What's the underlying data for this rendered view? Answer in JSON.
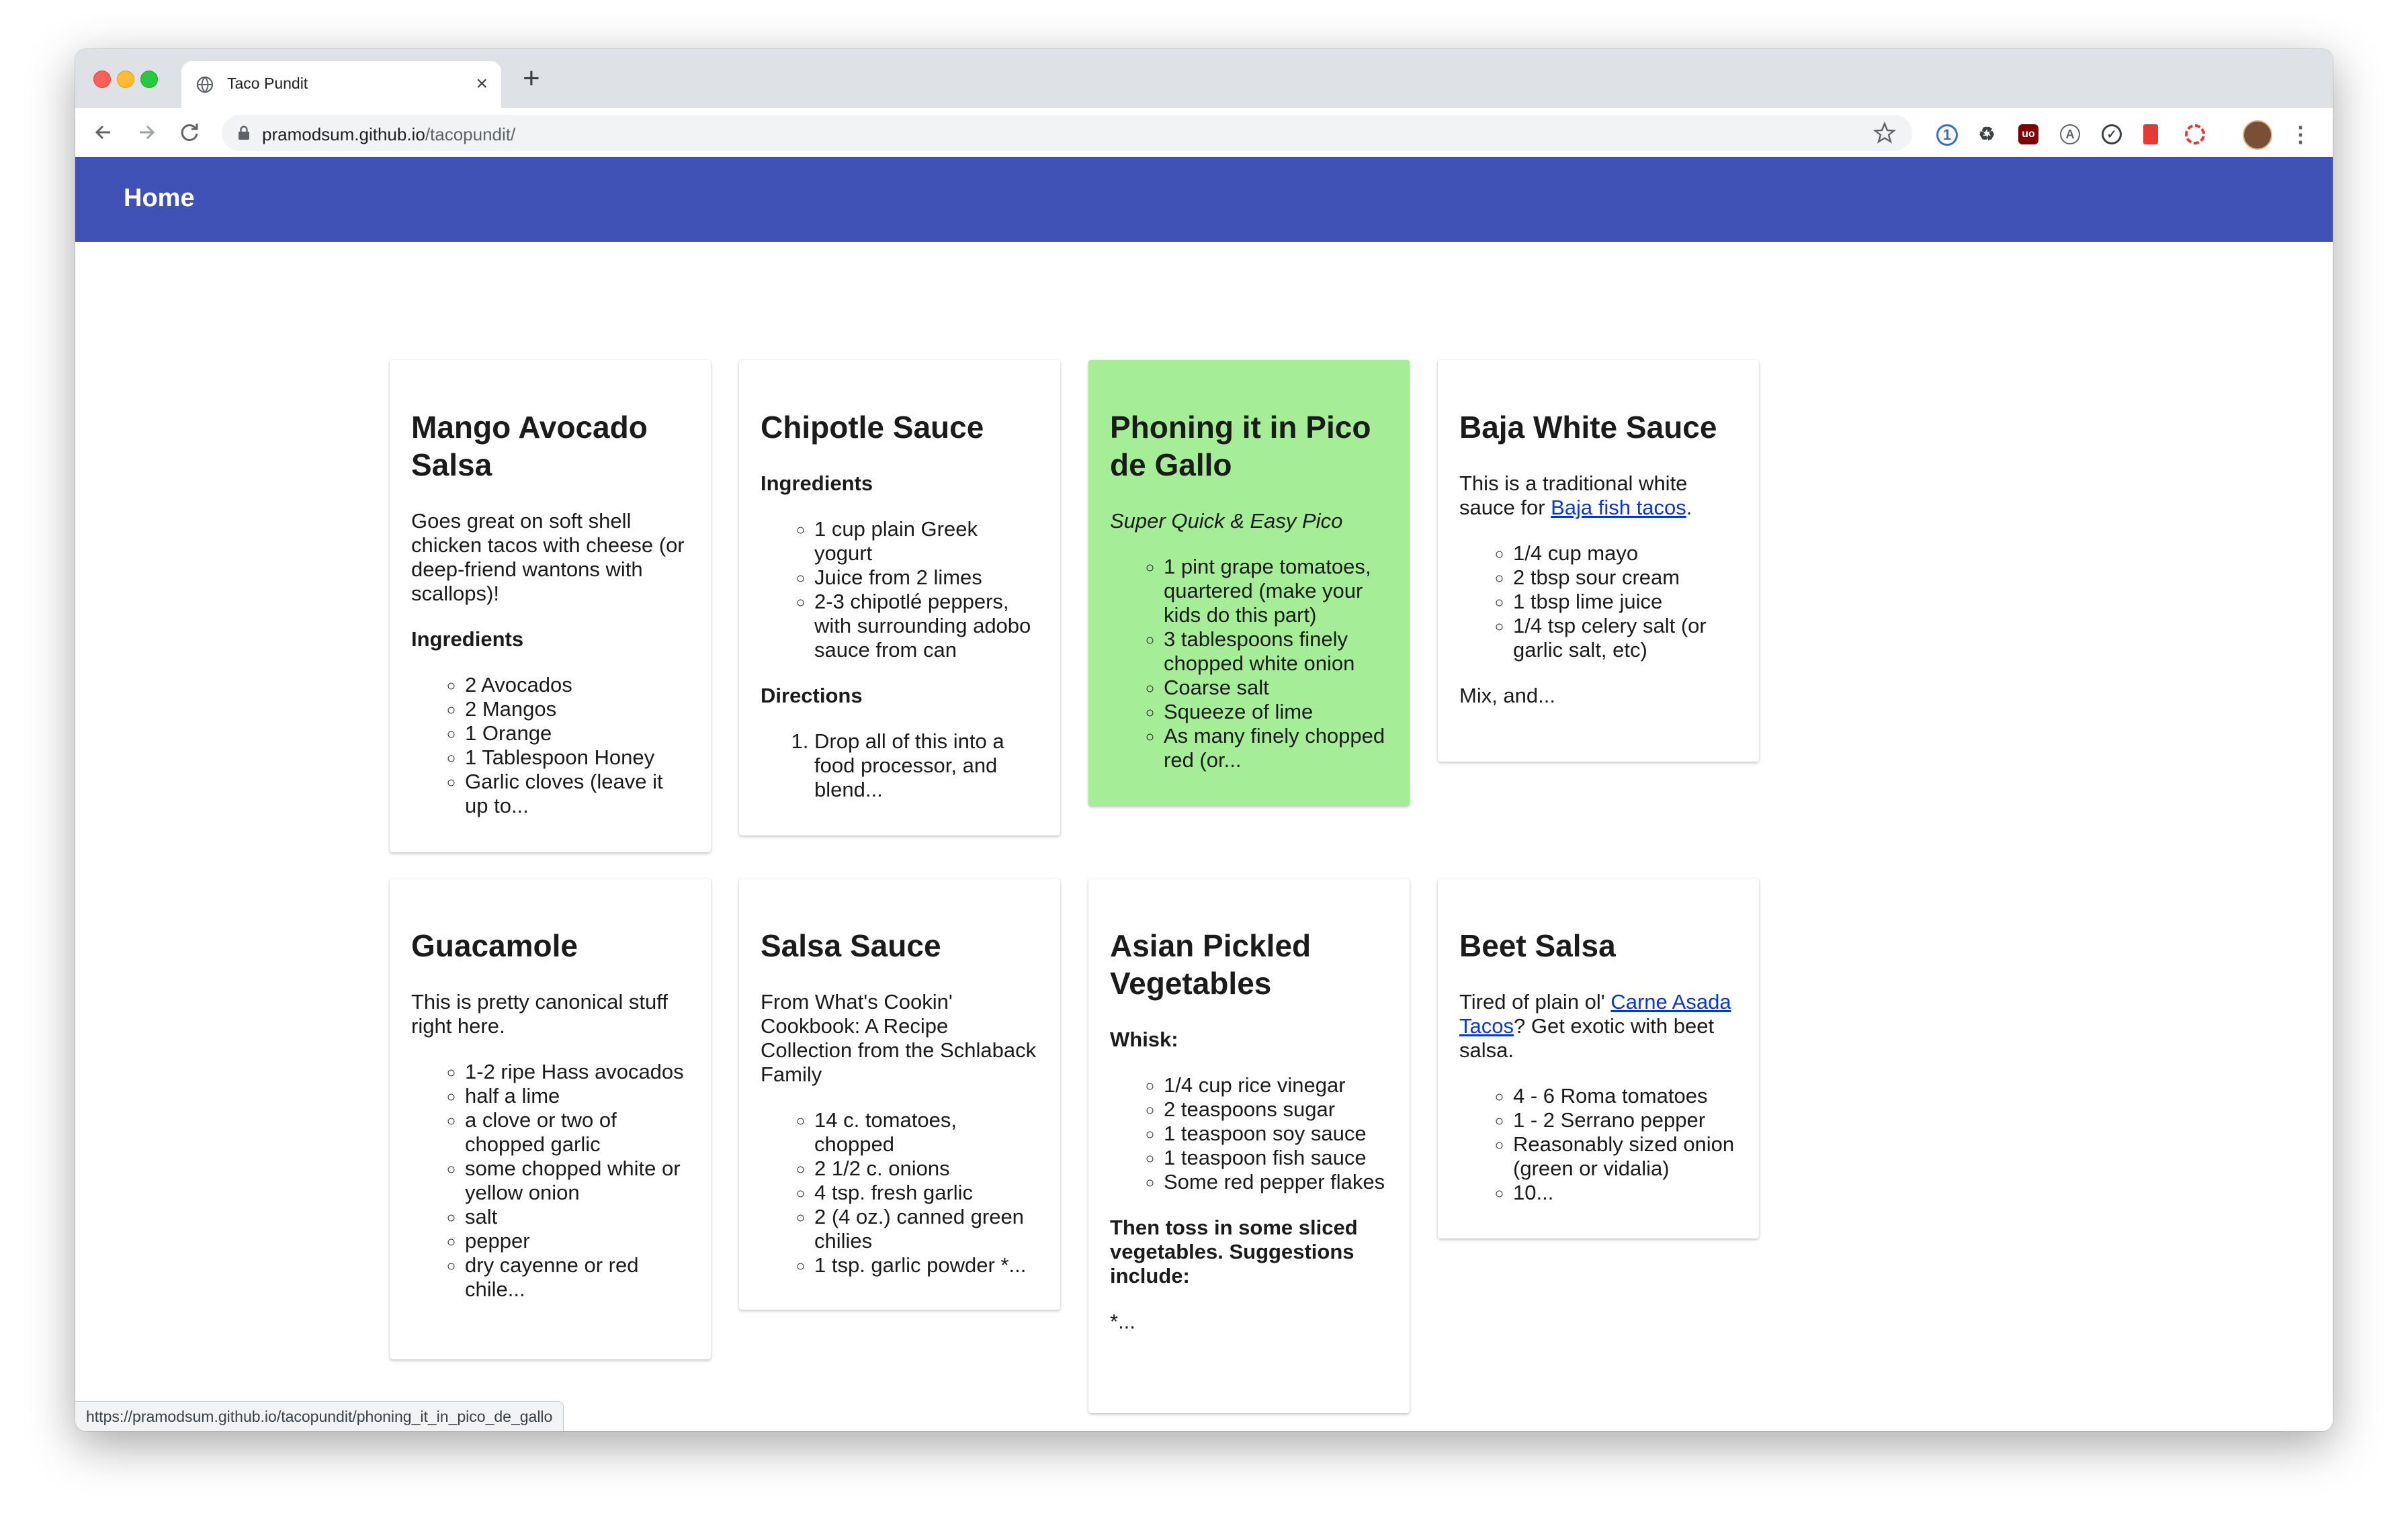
{
  "browser": {
    "tab_title": "Taco Pundit",
    "tab_close": "×",
    "new_tab": "+",
    "url_host": "pramodsum.github.io",
    "url_path": "/tacopundit/",
    "status_url": "https://pramodsum.github.io/tacopundit/phoning_it_in_pico_de_gallo",
    "extensions": [
      "1password-icon",
      "recycle-icon",
      "ublock-icon",
      "a-icon",
      "check-circle-icon",
      "bookmark-icon",
      "lifering-icon",
      "avatar",
      "more-icon"
    ]
  },
  "appbar": {
    "home": "Home"
  },
  "cards": {
    "mango": {
      "title": "Mango Avocado Salsa",
      "desc": "Goes great on soft shell chicken tacos with cheese (or deep-friend wantons with scallops)!",
      "ingredients_label": "Ingredients",
      "items": [
        "2 Avocados",
        "2 Mangos",
        "1 Orange",
        "1 Tablespoon Honey",
        "Garlic cloves (leave it up to..."
      ]
    },
    "chipotle": {
      "title": "Chipotle Sauce",
      "ingredients_label": "Ingredients",
      "items": [
        "1 cup plain Greek yogurt",
        "Juice from 2 limes",
        "2-3 chipotlé peppers, with surrounding adobo sauce from can"
      ],
      "directions_label": "Directions",
      "steps": [
        "Drop all of this into a food processor, and blend..."
      ]
    },
    "pico": {
      "title": "Phoning it in Pico de Gallo",
      "subtitle": "Super Quick & Easy Pico",
      "items": [
        "1 pint grape tomatoes, quartered (make your kids do this part)",
        "3 tablespoons finely chopped white onion",
        "Coarse salt",
        "Squeeze of lime",
        "As many finely chopped red (or..."
      ]
    },
    "baja": {
      "title": "Baja White Sauce",
      "desc_pre": "This is a traditional white sauce for ",
      "desc_link": "Baja fish tacos",
      "desc_post": ".",
      "items": [
        "1/4 cup mayo",
        "2 tbsp sour cream",
        "1 tbsp lime juice",
        "1/4 tsp celery salt (or garlic salt, etc)"
      ],
      "footer": "Mix, and..."
    },
    "guac": {
      "title": "Guacamole",
      "desc": "This is pretty canonical stuff right here.",
      "items": [
        "1-2 ripe Hass avocados",
        "half a lime",
        "a clove or two of chopped garlic",
        "some chopped white or yellow onion",
        "salt",
        "pepper",
        "dry cayenne or red chile..."
      ]
    },
    "salsa": {
      "title": "Salsa Sauce",
      "desc": "From What's Cookin' Cookbook: A Recipe Collection from the Schlaback Family",
      "items": [
        "14 c. tomatoes, chopped",
        "2 1/2 c. onions",
        "4 tsp. fresh garlic",
        "2 (4 oz.) canned green chilies",
        "1 tsp. garlic powder *..."
      ]
    },
    "asian": {
      "title": "Asian Pickled Vegetables",
      "whisk_label": "Whisk:",
      "items": [
        "1/4 cup rice vinegar",
        "2 teaspoons sugar",
        "1 teaspoon soy sauce",
        "1 teaspoon fish sauce",
        "Some red pepper flakes"
      ],
      "then_label": "Then toss in some sliced vegetables. Suggestions include:",
      "footer": "*..."
    },
    "beet": {
      "title": "Beet Salsa",
      "desc_pre": "Tired of plain ol' ",
      "desc_link": "Carne Asada Tacos",
      "desc_post": "? Get exotic with beet salsa.",
      "items": [
        "4 - 6 Roma tomatoes",
        "1 - 2 Serrano pepper",
        "Reasonably sized onion (green or vidalia)",
        "10..."
      ]
    }
  }
}
